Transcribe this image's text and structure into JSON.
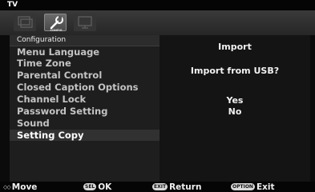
{
  "window": {
    "title": "TV"
  },
  "tabs": [
    {
      "icon": "picture-icon"
    },
    {
      "icon": "configuration-icon",
      "label": "CONFIG",
      "active": true
    },
    {
      "icon": "screen-icon"
    }
  ],
  "left_panel": {
    "header": "Configuration",
    "items": [
      {
        "label": "Menu Language"
      },
      {
        "label": "Time Zone"
      },
      {
        "label": "Parental Control"
      },
      {
        "label": "Closed Caption Options"
      },
      {
        "label": "Channel Lock"
      },
      {
        "label": "Password Setting"
      },
      {
        "label": "Sound"
      },
      {
        "label": "Setting Copy",
        "selected": true
      }
    ]
  },
  "right_panel": {
    "title": "Import",
    "question": "Import from USB?",
    "options": [
      "Yes",
      "No"
    ]
  },
  "bottom_bar": {
    "move": {
      "key": "◇◇",
      "label": "Move"
    },
    "ok": {
      "key": "SEL",
      "label": "OK"
    },
    "ret": {
      "key": "EXIT",
      "label": "Return"
    },
    "exit": {
      "key": "OPTION",
      "label": "Exit"
    }
  }
}
